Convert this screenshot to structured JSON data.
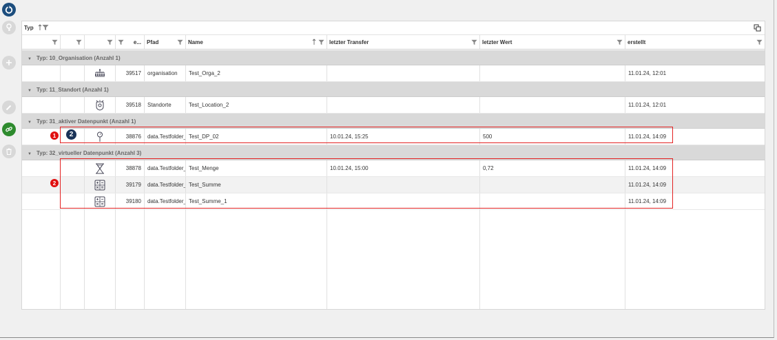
{
  "toolbar": {
    "refresh": "refresh-icon",
    "items": [
      "key-icon",
      "add-icon",
      "edit-icon",
      "link-icon",
      "delete-icon"
    ]
  },
  "group_bar": {
    "label": "Typ"
  },
  "columns": {
    "c4": "e...",
    "pfad": "Pfad",
    "name": "Name",
    "transfer": "letzter Transfer",
    "wert": "letzter Wert",
    "erstellt": "erstellt"
  },
  "groups": [
    {
      "title": "Typ: 10_Organisation (Anzahl 1)"
    },
    {
      "title": "Typ: 11_Standort (Anzahl 1)"
    },
    {
      "title": "Typ: 31_aktiver Datenpunkt (Anzahl 1)"
    },
    {
      "title": "Typ: 32_virtueller Datenpunkt (Anzahl 3)"
    }
  ],
  "rows": [
    {
      "icon": "org-chart-icon",
      "id": "39517",
      "pfad": "organisation",
      "name": "Test_Orga_2",
      "transfer": "",
      "wert": "",
      "erstellt": "11.01.24, 12:01"
    },
    {
      "icon": "location-icon",
      "id": "39518",
      "pfad": "Standorte",
      "name": "Test_Location_2",
      "transfer": "",
      "wert": "",
      "erstellt": "11.01.24, 12:01"
    },
    {
      "icon": "sensor-pin-icon",
      "id": "38876",
      "pfad": "data.Testfolder_",
      "name": "Test_DP_02",
      "transfer": "10.01.24, 15:25",
      "wert": "500",
      "erstellt": "11.01.24, 14:09"
    },
    {
      "icon": "quantity-icon",
      "id": "38878",
      "pfad": "data.Testfolder_",
      "name": "Test_Menge",
      "transfer": "10.01.24, 15:00",
      "wert": "0,72",
      "erstellt": "11.01.24, 14:09"
    },
    {
      "icon": "calculator-icon",
      "id": "39179",
      "pfad": "data.Testfolder_",
      "name": "Test_Summe",
      "transfer": "",
      "wert": "",
      "erstellt": "11.01.24, 14:09"
    },
    {
      "icon": "calculator-icon",
      "id": "39180",
      "pfad": "data.Testfolder_",
      "name": "Test_Summe_1",
      "transfer": "",
      "wert": "",
      "erstellt": "11.01.24, 14:09"
    }
  ],
  "annotations": {
    "badge1": "1",
    "badge2a": "2",
    "badge2b": "2"
  },
  "colors": {
    "accent": "#1d4e7e",
    "highlight": "#e32020",
    "badge_red": "#e01010",
    "badge_navy": "#1a3358",
    "link_green": "#2e8b2e",
    "group_row": "#d9d9d9"
  }
}
